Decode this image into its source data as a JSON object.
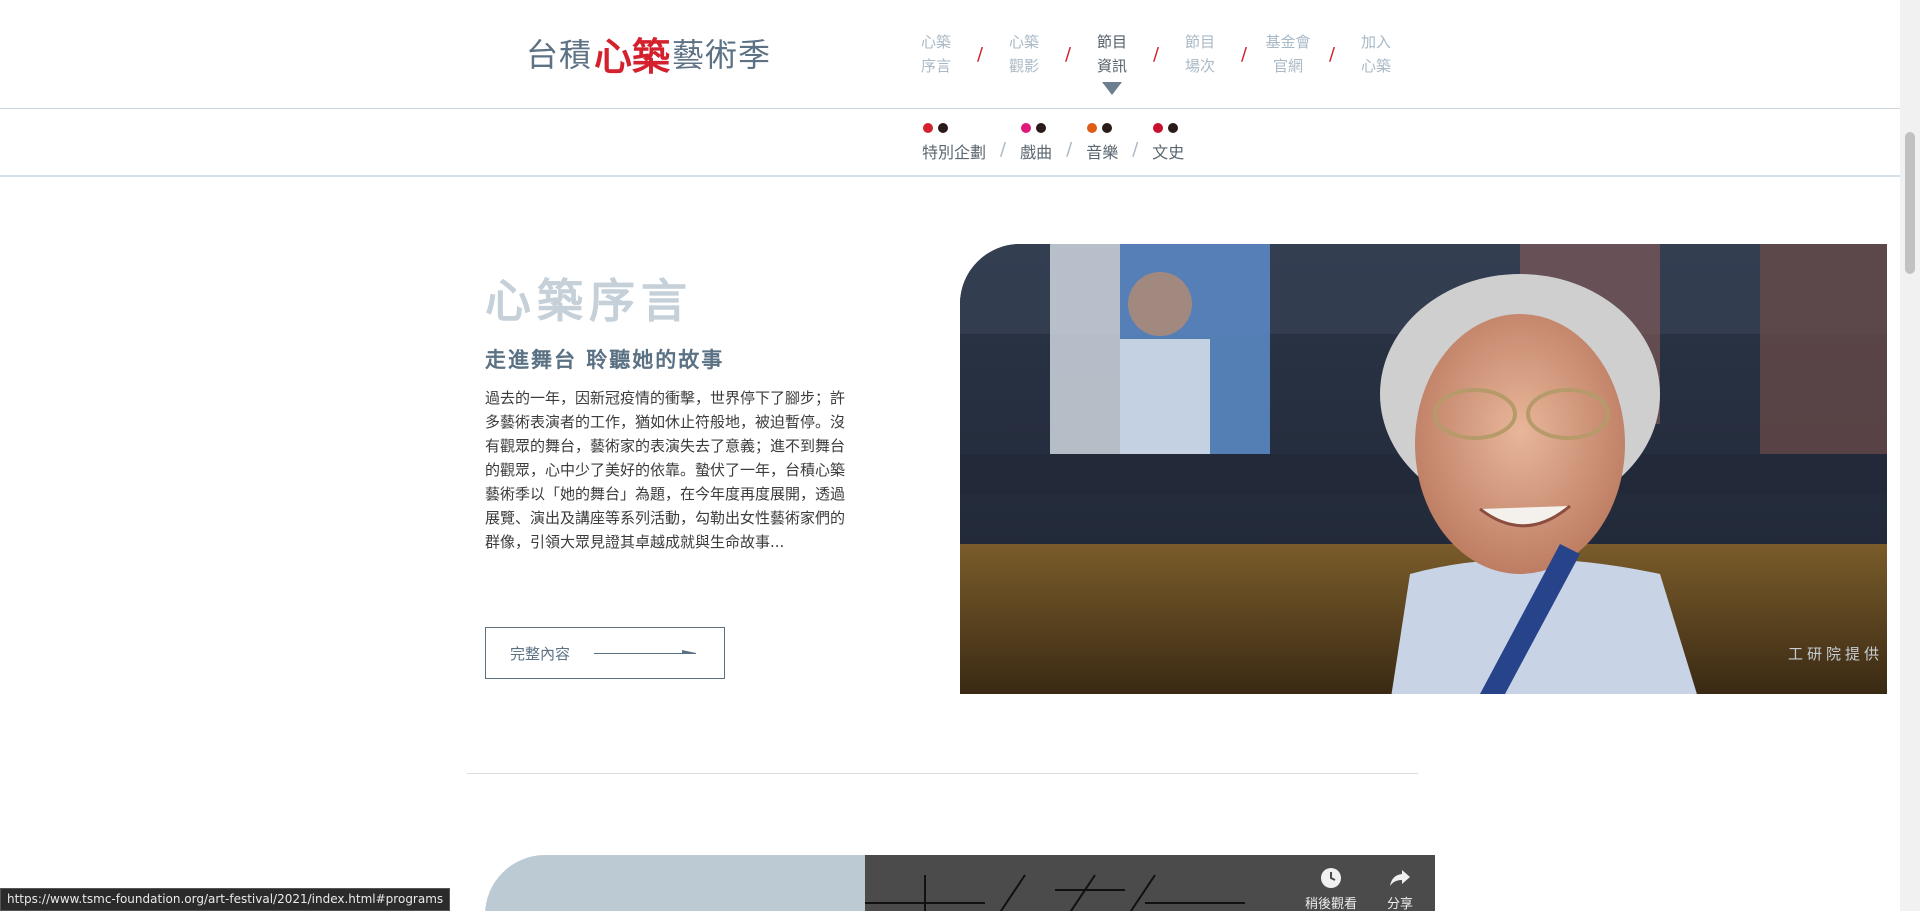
{
  "logo": {
    "part1": "台積",
    "mark": "心築",
    "part2": "藝術季"
  },
  "nav": [
    {
      "line1": "心築",
      "line2": "序言",
      "active": false
    },
    {
      "line1": "心築",
      "line2": "觀影",
      "active": false
    },
    {
      "line1": "節目",
      "line2": "資訊",
      "active": true
    },
    {
      "line1": "節目",
      "line2": "場次",
      "active": false
    },
    {
      "line1": "基金會",
      "line2": "官網",
      "active": false
    },
    {
      "line1": "加入",
      "line2": "心築",
      "active": false
    }
  ],
  "nav_separator": "/",
  "subnav": [
    {
      "label": "特別企劃",
      "dot_colors": [
        "#d3212e",
        "#2a1a1a"
      ]
    },
    {
      "label": "戲曲",
      "dot_colors": [
        "#e0197d",
        "#2a1a1a"
      ]
    },
    {
      "label": "音樂",
      "dot_colors": [
        "#e05a1a",
        "#2a1a1a"
      ]
    },
    {
      "label": "文史",
      "dot_colors": [
        "#c8102e",
        "#2a1a1a"
      ]
    }
  ],
  "subnav_separator": "/",
  "intro": {
    "title": "心築序言",
    "subtitle": "走進舞台 聆聽她的故事",
    "body": "過去的一年，因新冠疫情的衝擊，世界停下了腳步；許多藝術表演者的工作，猶如休止符般地，被迫暫停。沒有觀眾的舞台，藝術家的表演失去了意義；進不到舞台的觀眾，心中少了美好的依靠。蟄伏了一年，台積心築藝術季以「她的舞台」為題，在今年度再度展開，透過展覽、演出及講座等系列活動，勾勒出女性藝術家們的群像，引領大眾見證其卓越成就與生命故事...",
    "more_label": "完整內容",
    "photo_credit": "工研院提供"
  },
  "video": {
    "watch_later_label": "稍後觀看",
    "share_label": "分享"
  },
  "status_url": "https://www.tsmc-foundation.org/art-festival/2021/index.html#programs",
  "colors": {
    "accent_red": "#d3212e",
    "slate": "#5b7184",
    "light_slate": "#a9b9c6"
  }
}
